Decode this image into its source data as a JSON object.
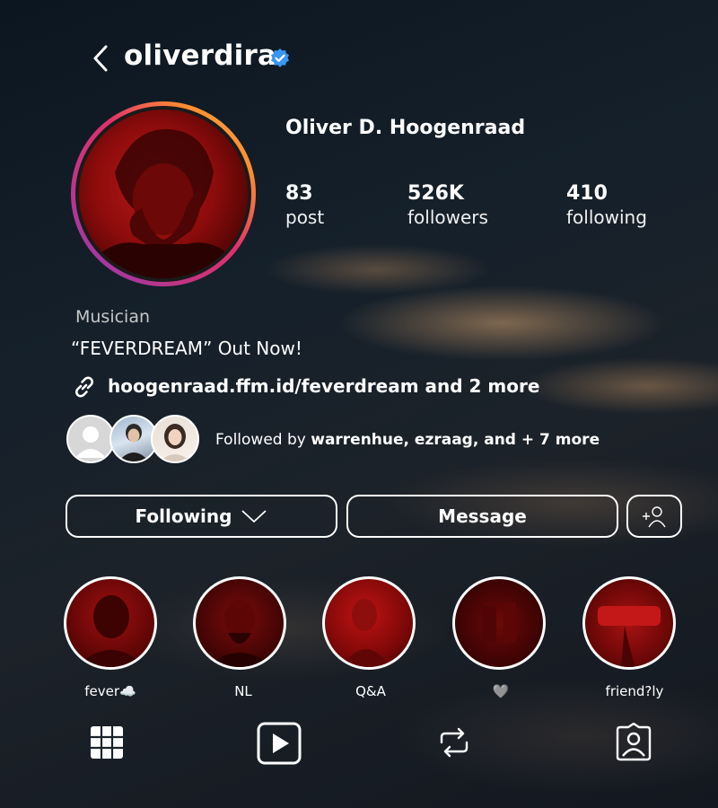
{
  "header": {
    "username": "oliverdira",
    "verified": true,
    "back_icon": "chevron-left-icon",
    "verified_color": "#3897f0"
  },
  "profile": {
    "full_name": "Oliver D. Hoogenraad",
    "stats": [
      {
        "value": "83",
        "label": "post"
      },
      {
        "value": "526K",
        "label": "followers"
      },
      {
        "value": "410",
        "label": "following"
      }
    ],
    "category": "Musician",
    "bio": "“FEVERDREAM” Out Now!",
    "link": "hoogenraad.ffm.id/feverdream and 2 more",
    "followed_by_prefix": "Followed by ",
    "followed_by_names": "warrenhue, ezraag, and + 7 more"
  },
  "actions": {
    "following_label": "Following",
    "message_label": "Message",
    "add_user_icon": "add-person-icon"
  },
  "highlights": [
    {
      "label": "fever☁️"
    },
    {
      "label": "NL"
    },
    {
      "label": "Q&A"
    },
    {
      "label": "🩶"
    },
    {
      "label": "friend?ly"
    }
  ],
  "tabs": [
    "grid-icon",
    "reels-icon",
    "repost-icon",
    "tagged-icon"
  ]
}
